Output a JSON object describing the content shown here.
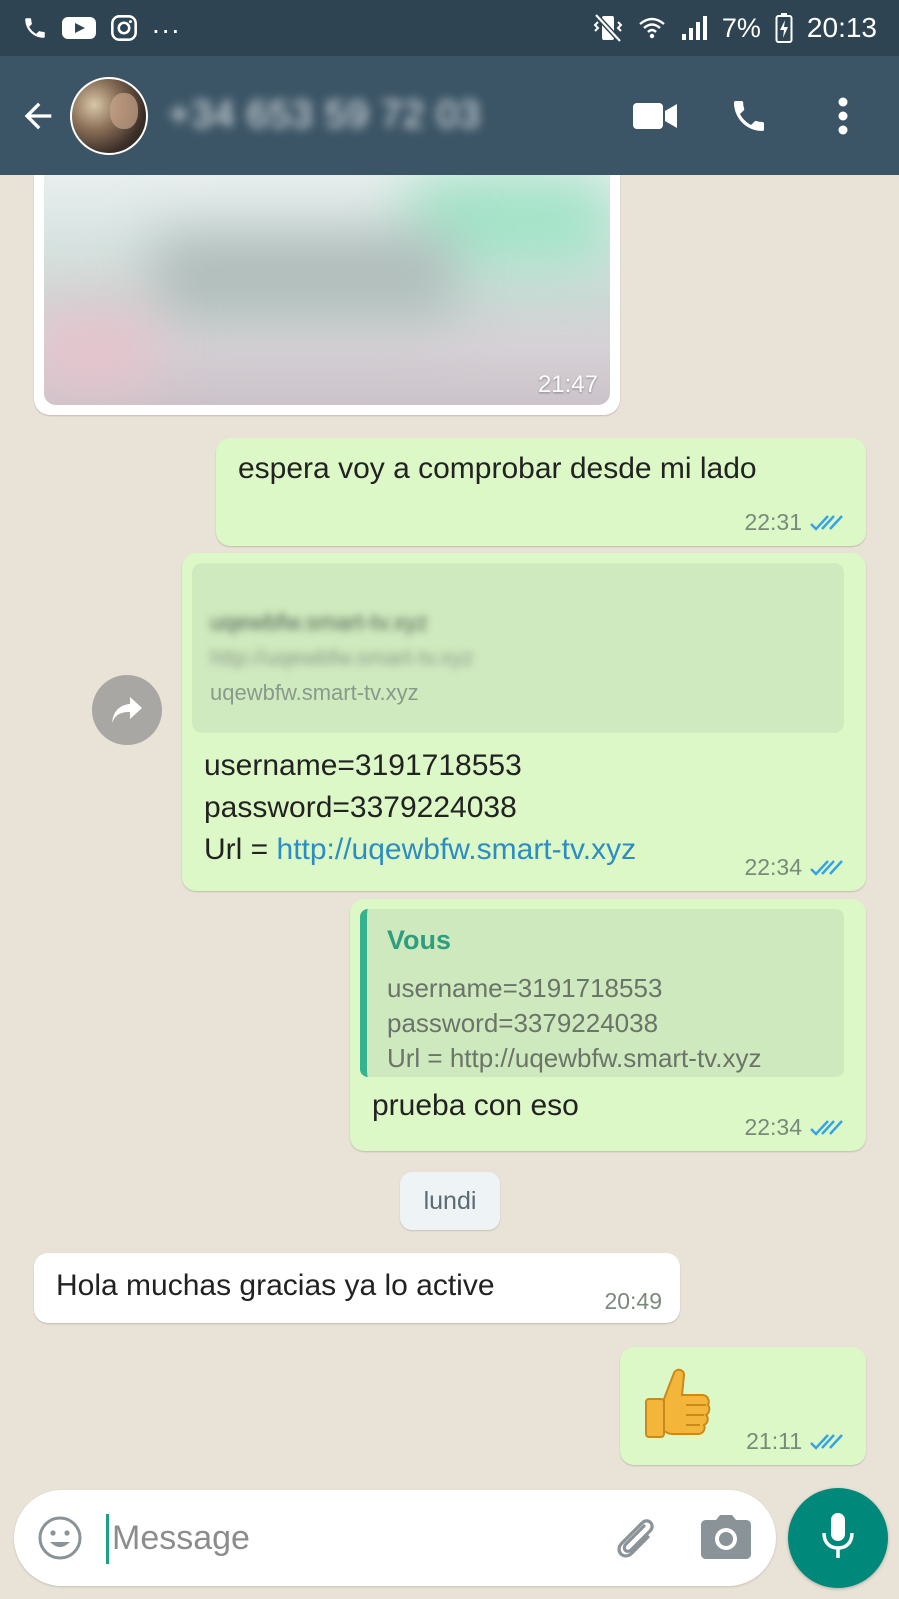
{
  "status_bar": {
    "dots": "...",
    "battery": "7%",
    "time": "20:13"
  },
  "header": {
    "contact_name": "+34 653 59 72 03",
    "icons": [
      "back-arrow-icon",
      "avatar",
      "video-call-icon",
      "phone-icon",
      "more-vert-icon"
    ]
  },
  "messages": {
    "image": {
      "time": "21:47"
    },
    "m1": {
      "text": "espera voy a comprobar desde mi lado",
      "time": "22:31"
    },
    "m2": {
      "preview_title": "uqewbfw.smart-tv.xyz",
      "preview_url": "http://uqewbfw.smart-tv.xyz",
      "preview_domain": "uqewbfw.smart-tv.xyz",
      "line1": "username=3191718553",
      "line2": "password=3379224038",
      "line3_prefix": "Url = ",
      "line3_link": "http://uqewbfw.smart-tv.xyz",
      "time": "22:34"
    },
    "m3": {
      "quote_author": "Vous",
      "quote_line1": "username=3191718553",
      "quote_line2": "password=3379224038",
      "quote_line3": "Url = http://uqewbfw.smart-tv.xyz",
      "text": "prueba con eso",
      "time": "22:34"
    },
    "date_divider": "lundi",
    "m4": {
      "text": "Hola muchas gracias ya lo active",
      "time": "20:49"
    },
    "m5": {
      "emoji": "👍",
      "time": "21:11"
    }
  },
  "input": {
    "placeholder": "Message"
  },
  "colors": {
    "status_bar": "#2f4452",
    "header": "#3c5566",
    "chat_background": "#e9e2d7",
    "outgoing_bubble": "#dcf8c6",
    "incoming_bubble": "#ffffff",
    "read_ticks": "#34a2e6",
    "accent": "#00897b"
  }
}
